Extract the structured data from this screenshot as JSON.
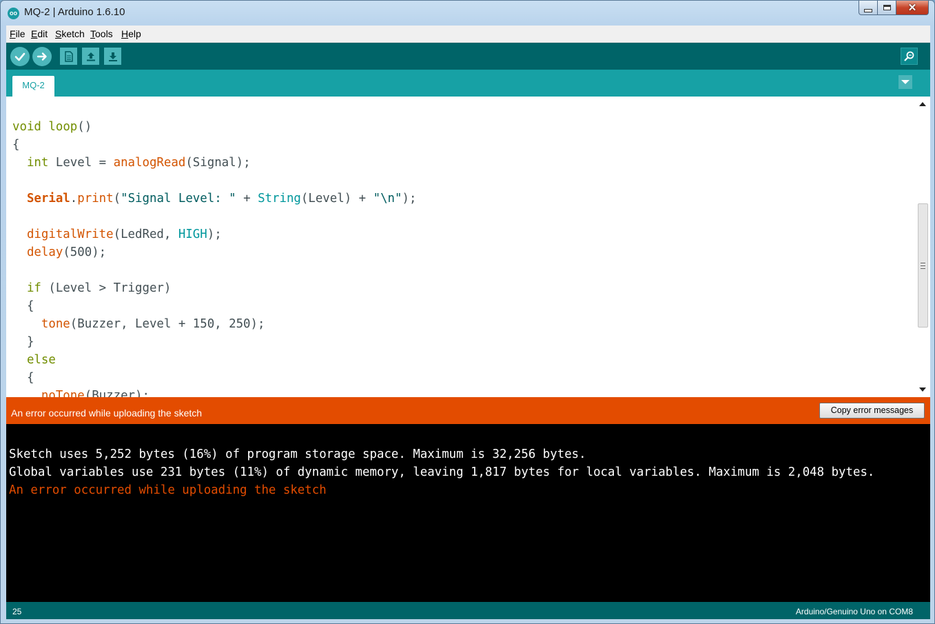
{
  "window": {
    "title": "MQ-2 | Arduino 1.6.10",
    "logo": "oo",
    "controls": {
      "minimize": "minimize-icon",
      "maximize": "maximize-icon",
      "close": "✕"
    }
  },
  "menubar": {
    "items": [
      {
        "first": "F",
        "rest": "ile"
      },
      {
        "first": "E",
        "rest": "dit"
      },
      {
        "first": "S",
        "rest": "ketch"
      },
      {
        "first": "T",
        "rest": "ools"
      },
      {
        "first": "H",
        "rest": "elp"
      }
    ]
  },
  "toolbar": {
    "buttons": [
      "verify-icon",
      "upload-icon",
      "new-icon",
      "open-icon",
      "save-icon"
    ],
    "serial_monitor": "serial-monitor-icon"
  },
  "tabs": {
    "active": "MQ-2"
  },
  "editor": {
    "lines": [
      [
        {
          "t": "void",
          "c": "kw"
        },
        {
          "t": " "
        },
        {
          "t": "loop",
          "c": "kw"
        },
        {
          "t": "()"
        }
      ],
      [
        {
          "t": "{"
        }
      ],
      [
        {
          "t": "  "
        },
        {
          "t": "int",
          "c": "kw"
        },
        {
          "t": " Level = "
        },
        {
          "t": "analogRead",
          "c": "fn"
        },
        {
          "t": "(Signal);"
        }
      ],
      [
        {
          "t": ""
        }
      ],
      [
        {
          "t": "  "
        },
        {
          "t": "Serial",
          "c": "fnb"
        },
        {
          "t": "."
        },
        {
          "t": "print",
          "c": "fn"
        },
        {
          "t": "("
        },
        {
          "t": "\"Signal Level: \"",
          "c": "str"
        },
        {
          "t": " + "
        },
        {
          "t": "String",
          "c": "con"
        },
        {
          "t": "(Level) + "
        },
        {
          "t": "\"\\n\"",
          "c": "str"
        },
        {
          "t": ");"
        }
      ],
      [
        {
          "t": ""
        }
      ],
      [
        {
          "t": "  "
        },
        {
          "t": "digitalWrite",
          "c": "fn"
        },
        {
          "t": "(LedRed, "
        },
        {
          "t": "HIGH",
          "c": "con"
        },
        {
          "t": ");"
        }
      ],
      [
        {
          "t": "  "
        },
        {
          "t": "delay",
          "c": "fn"
        },
        {
          "t": "(500);"
        }
      ],
      [
        {
          "t": ""
        }
      ],
      [
        {
          "t": "  "
        },
        {
          "t": "if",
          "c": "kw"
        },
        {
          "t": " (Level > Trigger)"
        }
      ],
      [
        {
          "t": "  {"
        }
      ],
      [
        {
          "t": "    "
        },
        {
          "t": "tone",
          "c": "fn"
        },
        {
          "t": "(Buzzer, Level + 150, 250);"
        }
      ],
      [
        {
          "t": "  }"
        }
      ],
      [
        {
          "t": "  "
        },
        {
          "t": "else",
          "c": "kw"
        }
      ],
      [
        {
          "t": "  {"
        }
      ],
      [
        {
          "t": "    "
        },
        {
          "t": "noTone",
          "c": "fn"
        },
        {
          "t": "(Buzzer);"
        }
      ]
    ]
  },
  "errorbar": {
    "message": "An error occurred while uploading the sketch",
    "copy_button": "Copy error messages"
  },
  "console": {
    "lines": [
      {
        "text": "Sketch uses 5,252 bytes (16%) of program storage space. Maximum is 32,256 bytes.",
        "type": "normal"
      },
      {
        "text": "Global variables use 231 bytes (11%) of dynamic memory, leaving 1,817 bytes for local variables. Maximum is 2,048 bytes.",
        "type": "normal"
      },
      {
        "text": "An error occurred while uploading the sketch",
        "type": "error"
      }
    ]
  },
  "statusbar": {
    "line_number": "25",
    "board": "Arduino/Genuino Uno on COM8"
  },
  "colors": {
    "teal_dark": "#006468",
    "teal": "#17a1a5",
    "error_orange": "#e34c00"
  }
}
